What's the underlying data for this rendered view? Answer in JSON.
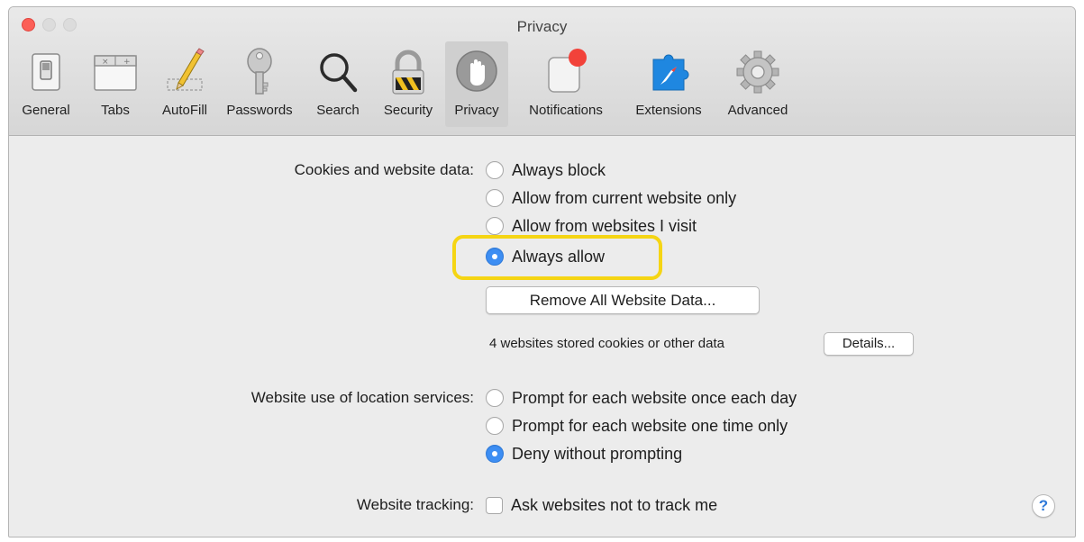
{
  "window": {
    "title": "Privacy"
  },
  "toolbar": {
    "items": [
      {
        "label": "General",
        "icon": "general-switch-icon",
        "selected": false
      },
      {
        "label": "Tabs",
        "icon": "tabs-icon",
        "selected": false
      },
      {
        "label": "AutoFill",
        "icon": "pencil-icon",
        "selected": false
      },
      {
        "label": "Passwords",
        "icon": "key-icon",
        "selected": false
      },
      {
        "label": "Search",
        "icon": "magnifier-icon",
        "selected": false
      },
      {
        "label": "Security",
        "icon": "padlock-icon",
        "selected": false
      },
      {
        "label": "Privacy",
        "icon": "hand-icon",
        "selected": true
      },
      {
        "label": "Notifications",
        "icon": "notification-badge-icon",
        "selected": false
      },
      {
        "label": "Extensions",
        "icon": "puzzle-compass-icon",
        "selected": false
      },
      {
        "label": "Advanced",
        "icon": "gear-icon",
        "selected": false
      }
    ]
  },
  "cookies": {
    "label": "Cookies and website data:",
    "options": [
      {
        "label": "Always block",
        "checked": false
      },
      {
        "label": "Allow from current website only",
        "checked": false
      },
      {
        "label": "Allow from websites I visit",
        "checked": false
      },
      {
        "label": "Always allow",
        "checked": true
      }
    ],
    "remove_button": "Remove All Website Data...",
    "stored_text": "4 websites stored cookies or other data",
    "details_button": "Details..."
  },
  "location": {
    "label": "Website use of location services:",
    "options": [
      {
        "label": "Prompt for each website once each day",
        "checked": false
      },
      {
        "label": "Prompt for each website one time only",
        "checked": false
      },
      {
        "label": "Deny without prompting",
        "checked": true
      }
    ]
  },
  "tracking": {
    "label": "Website tracking:",
    "checkbox_label": "Ask websites not to track me",
    "checked": false
  },
  "help_button": "?",
  "colors": {
    "accent": "#3d8ef3",
    "highlight": "#f5d514",
    "close": "#fc5f57"
  }
}
